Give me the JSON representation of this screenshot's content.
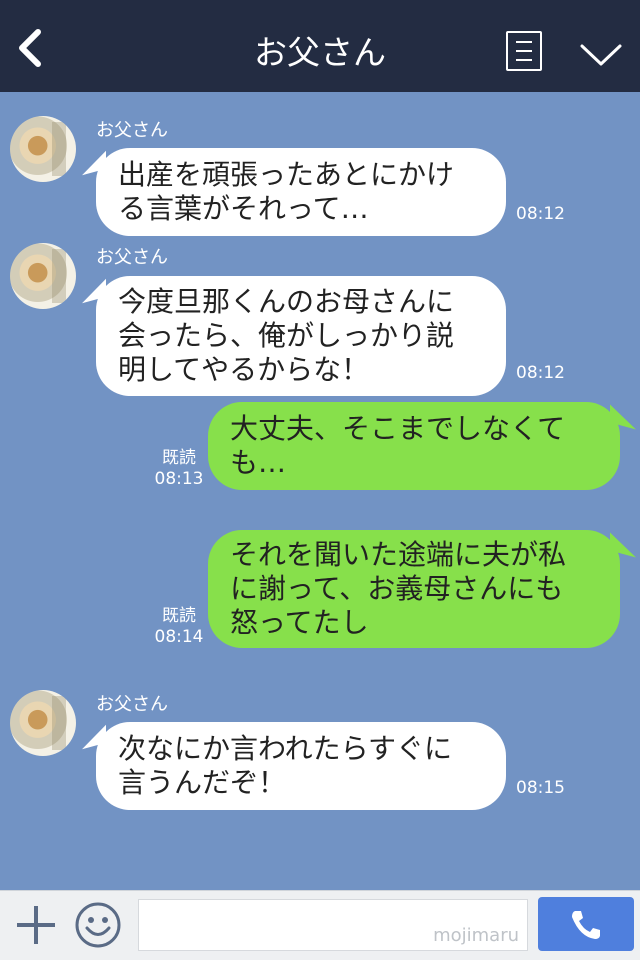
{
  "header": {
    "title": "お父さん",
    "back_icon": "chevron-left-icon",
    "menu_icon": "menu-icon",
    "more_icon": "chevron-down-icon"
  },
  "messages": [
    {
      "side": "in",
      "sender": "お父さん",
      "text": "出産を頑張ったあとにかけ\nる言葉がそれって…",
      "time": "08:12"
    },
    {
      "side": "in",
      "sender": "お父さん",
      "text": "今度旦那くんのお母さんに\n会ったら、俺がしっかり説\n明してやるからな！",
      "time": "08:12"
    },
    {
      "side": "out",
      "read": "既読",
      "text": "大丈夫、そこまでしなくて\nも…",
      "time": "08:13"
    },
    {
      "side": "out",
      "read": "既読",
      "text": "それを聞いた途端に夫が私\nに謝って、お義母さんにも\n怒ってたし",
      "time": "08:14"
    },
    {
      "side": "in",
      "sender": "お父さん",
      "text": "次なにか言われたらすぐに\n言うんだぞ！",
      "time": "08:15"
    }
  ],
  "footer": {
    "watermark": "mojimaru",
    "plus_icon": "plus-icon",
    "emoji_icon": "emoji-icon",
    "call_icon": "phone-icon"
  },
  "colors": {
    "header_bg": "#232c42",
    "chat_bg": "#7293c4",
    "bubble_out": "#87e04b",
    "send_button": "#4f7fdd"
  }
}
